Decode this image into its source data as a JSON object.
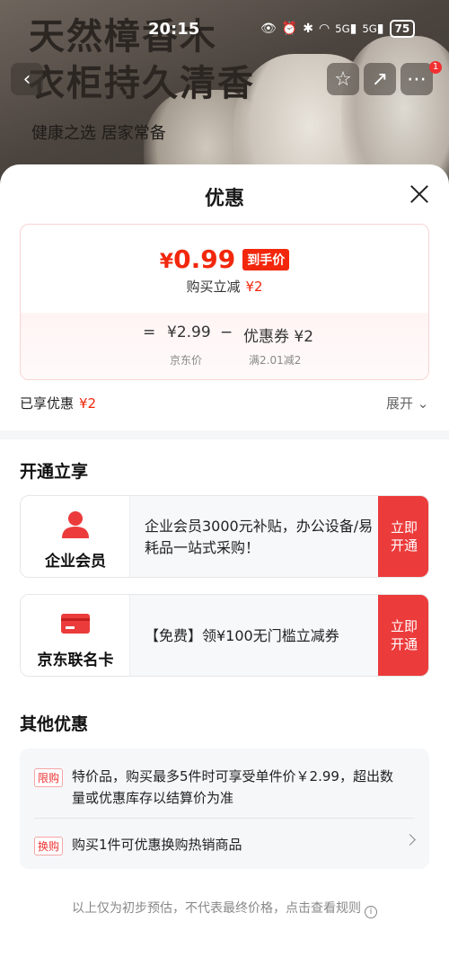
{
  "status_bar": {
    "time": "20:15",
    "signal1": "5G",
    "signal2": "5G",
    "battery": "75"
  },
  "hero": {
    "title_line1": "天然樟香木",
    "title_line2": "衣柜持久清香",
    "subtitle": "健康之选 居家常备",
    "badge_count": "1"
  },
  "sheet": {
    "title": "优惠",
    "price_card": {
      "currency": "¥",
      "final_price": "0.99",
      "final_tag": "到手价",
      "reduce_label": "购买立减",
      "reduce_value": "¥2",
      "formula": {
        "equals": "=",
        "base_price": "¥2.99",
        "minus": "−",
        "coupon": "优惠券 ¥2",
        "base_label": "京东价",
        "coupon_label": "满2.01减2"
      }
    },
    "enjoyed_label": "已享优惠",
    "enjoyed_value": "¥2",
    "expand_label": "展开",
    "open_section": {
      "title": "开通立享",
      "cards": [
        {
          "name": "企业会员",
          "desc": "企业会员3000元补贴，办公设备/易耗品一站式采购！",
          "cta": "立即开通",
          "icon": "user-icon"
        },
        {
          "name": "京东联名卡",
          "desc": "【免费】领¥100无门槛立减券",
          "cta": "立即开通",
          "icon": "credit-card-icon"
        }
      ]
    },
    "other_section": {
      "title": "其他优惠",
      "items": [
        {
          "badge": "限购",
          "text": "特价品，购买最多5件时可享受单件价￥2.99，超出数量或优惠库存以结算价为准"
        },
        {
          "badge": "换购",
          "text": "购买1件可优惠换购热销商品"
        }
      ]
    },
    "footer_note": "以上仅为初步预估，不代表最终价格，点击查看规则"
  },
  "colors": {
    "accent_red": "#f2270c",
    "cta_red": "#ec3b3b"
  }
}
